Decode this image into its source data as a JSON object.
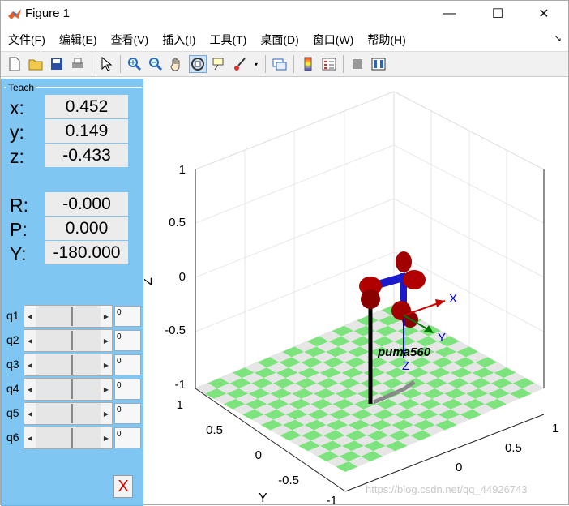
{
  "window": {
    "title": "Figure 1",
    "minimize_symbol": "—",
    "maximize_symbol": "☐",
    "close_symbol": "✕"
  },
  "menu": [
    {
      "label": "文件(F)"
    },
    {
      "label": "编辑(E)"
    },
    {
      "label": "查看(V)"
    },
    {
      "label": "插入(I)"
    },
    {
      "label": "工具(T)"
    },
    {
      "label": "桌面(D)"
    },
    {
      "label": "窗口(W)"
    },
    {
      "label": "帮助(H)"
    }
  ],
  "toolbar": {
    "icons": [
      "new-file-icon",
      "open-folder-icon",
      "save-icon",
      "print-icon",
      "pointer-icon",
      "zoom-in-icon",
      "zoom-out-icon",
      "pan-icon",
      "rotate-3d-icon",
      "data-cursor-icon",
      "brush-icon",
      "link-plot-icon",
      "colorbar-icon",
      "legend-icon",
      "hide-plot-tools-icon",
      "show-plot-tools-icon"
    ],
    "active": "rotate-3d-icon"
  },
  "teach": {
    "legend": "Teach",
    "pose": [
      {
        "label": "x:",
        "value": "0.452"
      },
      {
        "label": "y:",
        "value": "0.149"
      },
      {
        "label": "z:",
        "value": "-0.433"
      },
      {
        "label": "R:",
        "value": "-0.000"
      },
      {
        "label": "P:",
        "value": "0.000"
      },
      {
        "label": "Y:",
        "value": "-180.000"
      }
    ],
    "joints": [
      {
        "label": "q1",
        "value": "0"
      },
      {
        "label": "q2",
        "value": "0"
      },
      {
        "label": "q3",
        "value": "0"
      },
      {
        "label": "q4",
        "value": "0"
      },
      {
        "label": "q5",
        "value": "0"
      },
      {
        "label": "q6",
        "value": "0"
      }
    ],
    "close_label": "X"
  },
  "axes": {
    "z_label": "Z",
    "y_label": "Y",
    "z_ticks": [
      "1",
      "0.5",
      "0",
      "-0.5",
      "-1"
    ],
    "y_ticks": [
      "1",
      "0.5",
      "0",
      "-0.5",
      "-1"
    ],
    "x_ticks": [
      "1",
      "0.5",
      "0"
    ],
    "robot_name": "puma560",
    "frame_labels": {
      "x": "X",
      "y": "Y",
      "z": "Z"
    },
    "floor_colors": {
      "green": "#7de37d",
      "gray": "#e6e6e6"
    },
    "link_colors": {
      "joint": "#b10000",
      "link": "#1a1acc"
    }
  },
  "watermark": "https://blog.csdn.net/qq_44926743"
}
